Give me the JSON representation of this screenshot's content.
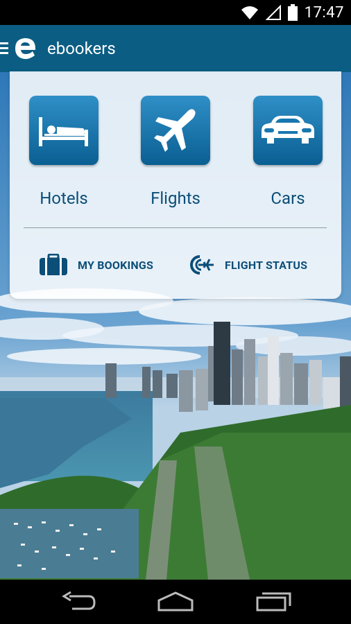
{
  "status_bar": {
    "time": "17:47",
    "icons": [
      "wifi-icon",
      "signal-icon",
      "battery-icon"
    ]
  },
  "app_bar": {
    "title": "ebookers",
    "logo_letter": "e"
  },
  "tiles": [
    {
      "label": "Hotels",
      "icon": "bed-icon"
    },
    {
      "label": "Flights",
      "icon": "airplane-icon"
    },
    {
      "label": "Cars",
      "icon": "car-icon"
    }
  ],
  "links": {
    "bookings": {
      "label": "MY BOOKINGS",
      "icon": "suitcase-icon"
    },
    "flight_status": {
      "label": "FLIGHT STATUS",
      "icon": "flight-status-icon"
    }
  },
  "colors": {
    "appbar": "#0b5d83",
    "tile": "#1877b0",
    "text": "#0b4e78"
  }
}
